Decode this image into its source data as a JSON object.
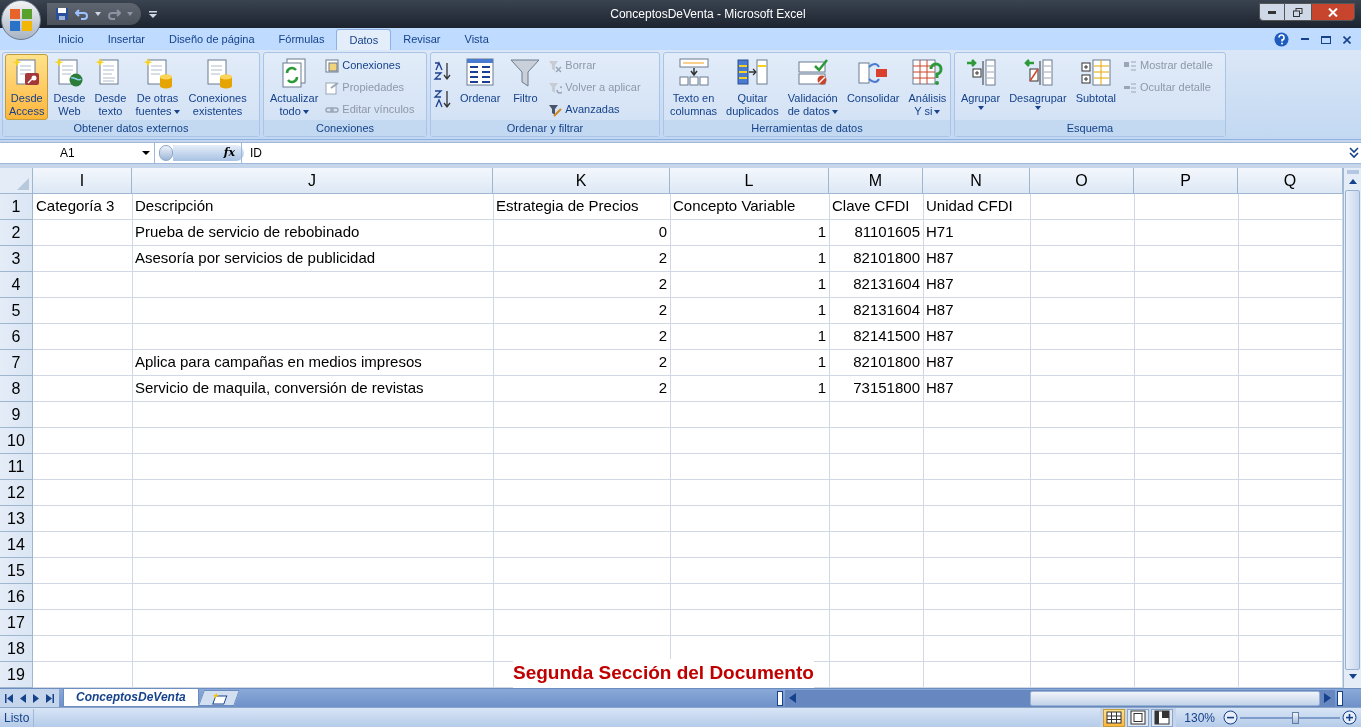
{
  "window": {
    "title": "ConceptosDeVenta - Microsoft Excel"
  },
  "tabs": [
    {
      "label": "Inicio",
      "selected": false
    },
    {
      "label": "Insertar",
      "selected": false
    },
    {
      "label": "Diseño de página",
      "selected": false
    },
    {
      "label": "Fórmulas",
      "selected": false
    },
    {
      "label": "Datos",
      "selected": true
    },
    {
      "label": "Revisar",
      "selected": false
    },
    {
      "label": "Vista",
      "selected": false
    }
  ],
  "ribbon_groups": [
    {
      "label": "Obtener datos externos",
      "buttons": [
        {
          "kind": "large",
          "label": "Desde\nAccess",
          "highlighted": true,
          "disabled": false,
          "dropdown": false
        },
        {
          "kind": "large",
          "label": "Desde\nWeb",
          "highlighted": false,
          "disabled": false,
          "dropdown": false
        },
        {
          "kind": "large",
          "label": "Desde\ntexto",
          "highlighted": false,
          "disabled": false,
          "dropdown": false
        },
        {
          "kind": "large",
          "label": "De otras\nfuentes",
          "highlighted": false,
          "disabled": false,
          "dropdown": true
        },
        {
          "kind": "large",
          "label": "Conexiones\nexistentes",
          "highlighted": false,
          "disabled": false,
          "dropdown": false
        }
      ]
    },
    {
      "label": "Conexiones",
      "buttons": [
        {
          "kind": "large",
          "label": "Actualizar\ntodo",
          "highlighted": false,
          "disabled": false,
          "dropdown": true
        },
        {
          "kind": "small",
          "label": "Conexiones",
          "highlighted": false,
          "disabled": false
        },
        {
          "kind": "small",
          "label": "Propiedades",
          "highlighted": false,
          "disabled": true
        },
        {
          "kind": "small",
          "label": "Editar vínculos",
          "highlighted": false,
          "disabled": true
        }
      ]
    },
    {
      "label": "Ordenar y filtrar",
      "buttons": [
        {
          "kind": "sort"
        },
        {
          "kind": "large",
          "label": "Ordenar",
          "highlighted": false,
          "disabled": false,
          "dropdown": false
        },
        {
          "kind": "large",
          "label": "Filtro",
          "highlighted": false,
          "disabled": false,
          "dropdown": false
        },
        {
          "kind": "small",
          "label": "Borrar",
          "highlighted": false,
          "disabled": true
        },
        {
          "kind": "small",
          "label": "Volver a aplicar",
          "highlighted": false,
          "disabled": true
        },
        {
          "kind": "small",
          "label": "Avanzadas",
          "highlighted": false,
          "disabled": false
        }
      ]
    },
    {
      "label": "Herramientas de datos",
      "buttons": [
        {
          "kind": "large",
          "label": "Texto en\ncolumnas",
          "highlighted": false,
          "disabled": false,
          "dropdown": false
        },
        {
          "kind": "large",
          "label": "Quitar\nduplicados",
          "highlighted": false,
          "disabled": false,
          "dropdown": false
        },
        {
          "kind": "large",
          "label": "Validación\nde datos",
          "highlighted": false,
          "disabled": false,
          "dropdown": true
        },
        {
          "kind": "large",
          "label": "Consolidar",
          "highlighted": false,
          "disabled": false,
          "dropdown": false
        },
        {
          "kind": "large",
          "label": "Análisis\nY si",
          "highlighted": false,
          "disabled": false,
          "dropdown": true
        }
      ]
    },
    {
      "label": "Esquema",
      "buttons": [
        {
          "kind": "large",
          "label": "Agrupar",
          "highlighted": false,
          "disabled": false,
          "dropdown": true
        },
        {
          "kind": "large",
          "label": "Desagrupar",
          "highlighted": false,
          "disabled": false,
          "dropdown": true
        },
        {
          "kind": "large",
          "label": "Subtotal",
          "highlighted": false,
          "disabled": false,
          "dropdown": false
        },
        {
          "kind": "small",
          "label": "Mostrar detalle",
          "highlighted": false,
          "disabled": true
        },
        {
          "kind": "small",
          "label": "Ocultar detalle",
          "highlighted": false,
          "disabled": true
        }
      ]
    }
  ],
  "formula_bar": {
    "name_box": "A1",
    "function_label": "fx",
    "formula": "ID"
  },
  "columns": [
    "I",
    "J",
    "K",
    "L",
    "M",
    "N",
    "O",
    "P",
    "Q"
  ],
  "rows": [
    {
      "number": "1",
      "cells": [
        {
          "text": "Categoría 3",
          "kind": "text"
        },
        {
          "text": "Descripción",
          "kind": "text"
        },
        {
          "text": "Estrategia de Precios",
          "kind": "text"
        },
        {
          "text": "Concepto Variable",
          "kind": "text"
        },
        {
          "text": "Clave CFDI",
          "kind": "text"
        },
        {
          "text": "Unidad CFDI",
          "kind": "text"
        }
      ]
    },
    {
      "number": "2",
      "cells": [
        {
          "kind": "empty"
        },
        {
          "text": "Prueba de servicio de rebobinado",
          "kind": "text"
        },
        {
          "text": "0",
          "kind": "number"
        },
        {
          "text": "1",
          "kind": "number"
        },
        {
          "text": "81101605",
          "kind": "number"
        },
        {
          "text": "H71",
          "kind": "text"
        }
      ]
    },
    {
      "number": "3",
      "cells": [
        {
          "kind": "empty"
        },
        {
          "text": "Asesoría por servicios de publicidad",
          "kind": "text"
        },
        {
          "text": "2",
          "kind": "number"
        },
        {
          "text": "1",
          "kind": "number"
        },
        {
          "text": "82101800",
          "kind": "number"
        },
        {
          "text": "H87",
          "kind": "text"
        }
      ]
    },
    {
      "number": "4",
      "cells": [
        {
          "kind": "empty"
        },
        {
          "kind": "empty"
        },
        {
          "text": "2",
          "kind": "number"
        },
        {
          "text": "1",
          "kind": "number"
        },
        {
          "text": "82131604",
          "kind": "number"
        },
        {
          "text": "H87",
          "kind": "text"
        }
      ]
    },
    {
      "number": "5",
      "cells": [
        {
          "kind": "empty"
        },
        {
          "kind": "empty"
        },
        {
          "text": "2",
          "kind": "number"
        },
        {
          "text": "1",
          "kind": "number"
        },
        {
          "text": "82131604",
          "kind": "number"
        },
        {
          "text": "H87",
          "kind": "text"
        }
      ]
    },
    {
      "number": "6",
      "cells": [
        {
          "kind": "empty"
        },
        {
          "kind": "empty"
        },
        {
          "text": "2",
          "kind": "number"
        },
        {
          "text": "1",
          "kind": "number"
        },
        {
          "text": "82141500",
          "kind": "number"
        },
        {
          "text": "H87",
          "kind": "text"
        }
      ]
    },
    {
      "number": "7",
      "cells": [
        {
          "kind": "empty"
        },
        {
          "text": "Aplica para campañas en medios impresos",
          "kind": "text"
        },
        {
          "text": "2",
          "kind": "number"
        },
        {
          "text": "1",
          "kind": "number"
        },
        {
          "text": "82101800",
          "kind": "number"
        },
        {
          "text": "H87",
          "kind": "text"
        }
      ]
    },
    {
      "number": "8",
      "cells": [
        {
          "kind": "empty"
        },
        {
          "text": "Servicio de maquila, conversión de revistas",
          "kind": "text"
        },
        {
          "text": "2",
          "kind": "number"
        },
        {
          "text": "1",
          "kind": "number"
        },
        {
          "text": "73151800",
          "kind": "number"
        },
        {
          "text": "H87",
          "kind": "text"
        }
      ]
    },
    {
      "number": "9",
      "cells": []
    },
    {
      "number": "10",
      "cells": []
    },
    {
      "number": "11",
      "cells": []
    },
    {
      "number": "12",
      "cells": []
    },
    {
      "number": "13",
      "cells": []
    },
    {
      "number": "14",
      "cells": []
    },
    {
      "number": "15",
      "cells": []
    },
    {
      "number": "16",
      "cells": []
    },
    {
      "number": "17",
      "cells": []
    },
    {
      "number": "18",
      "cells": []
    },
    {
      "number": "19",
      "cells": []
    }
  ],
  "overlay_caption": "Segunda Sección del Documento",
  "sheet_tabs": [
    {
      "label": "ConceptosDeVenta",
      "selected": true
    }
  ],
  "status_bar": {
    "text": "Listo",
    "zoom": "130%",
    "view_buttons": [
      {
        "kind": "normal",
        "selected": true
      },
      {
        "kind": "page_layout",
        "selected": false
      },
      {
        "kind": "page_break",
        "selected": false
      }
    ],
    "zoom_slider": {
      "level": 0.56
    }
  }
}
